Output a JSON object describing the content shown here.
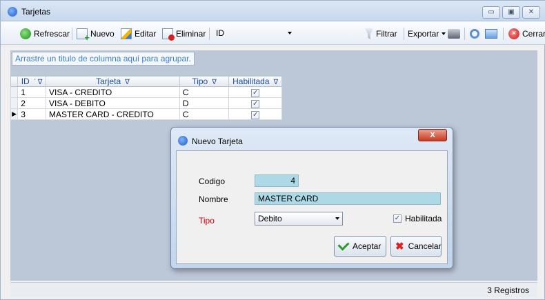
{
  "window": {
    "title": "Tarjetas"
  },
  "toolbar": {
    "refresh": "Refrescar",
    "new": "Nuevo",
    "edit": "Editar",
    "delete": "Eliminar",
    "column_combo": "ID",
    "filter": "Filtrar",
    "export": "Exportar",
    "close": "Cerrar"
  },
  "group_hint": "Arrastre un titulo de columna aquí para agrupar.",
  "grid": {
    "columns": [
      "ID",
      "Tarjeta",
      "Tipo",
      "Habilitada"
    ],
    "rows": [
      {
        "id": "1",
        "tarjeta": "VISA - CREDITO",
        "tipo": "C",
        "habilitada": true
      },
      {
        "id": "2",
        "tarjeta": "VISA - DEBITO",
        "tipo": "D",
        "habilitada": true
      },
      {
        "id": "3",
        "tarjeta": "MASTER CARD - CREDITO",
        "tipo": "C",
        "habilitada": true
      }
    ]
  },
  "status": {
    "records": "3 Registros"
  },
  "dialog": {
    "title": "Nuevo Tarjeta",
    "codigo_label": "Codigo",
    "codigo_value": "4",
    "nombre_label": "Nombre",
    "nombre_value": "MASTER CARD",
    "tipo_label": "Tipo",
    "tipo_value": "Debito",
    "habilitada_label": "Habilitada",
    "habilitada_checked": true,
    "accept": "Aceptar",
    "cancel": "Cancelar"
  },
  "colors": {
    "required_label": "#d40000",
    "link_text": "#3a7fd0",
    "field_bg": "#add8e6"
  }
}
